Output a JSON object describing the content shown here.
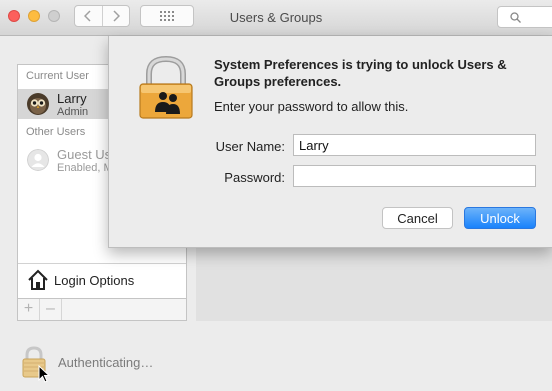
{
  "window": {
    "title": "Users & Groups"
  },
  "toolbar": {
    "back_icon": "chevron-left-icon",
    "forward_icon": "chevron-right-icon",
    "show_all_icon": "grid-icon",
    "search_icon": "search-icon"
  },
  "sidebar": {
    "current_user_header": "Current User",
    "other_users_header": "Other Users",
    "current_user": {
      "name": "Larry",
      "role": "Admin"
    },
    "other_users": [
      {
        "name": "Guest User",
        "role": "Enabled, Managed"
      }
    ],
    "login_options_label": "Login Options",
    "add_label": "+",
    "remove_label": "–"
  },
  "status": {
    "text": "Authenticating…"
  },
  "dialog": {
    "title": "System Preferences is trying to unlock Users & Groups preferences.",
    "message": "Enter your password to allow this.",
    "username_label": "User Name:",
    "username_value": "Larry",
    "password_label": "Password:",
    "password_value": "",
    "cancel_label": "Cancel",
    "unlock_label": "Unlock"
  },
  "colors": {
    "accent_blue": "#1a82fb",
    "lock_gold": "#e8a63a",
    "close_red": "#fc605c",
    "minimize_yellow": "#fdbc40"
  }
}
